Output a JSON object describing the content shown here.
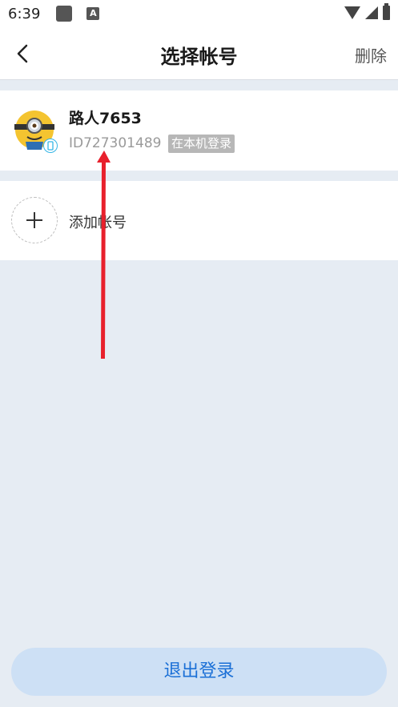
{
  "status_bar": {
    "time": "6:39",
    "a_icon_letter": "A"
  },
  "nav": {
    "title": "选择帐号",
    "delete_label": "删除"
  },
  "account": {
    "name": "路人7653",
    "id": "ID727301489",
    "badge": "在本机登录"
  },
  "add_account": {
    "label": "添加帐号"
  },
  "logout": {
    "label": "退出登录"
  },
  "colors": {
    "accent": "#1a6fd6",
    "button_bg": "#cde0f5",
    "page_bg": "#e6ecf3",
    "annotation_arrow": "#e8202c"
  }
}
